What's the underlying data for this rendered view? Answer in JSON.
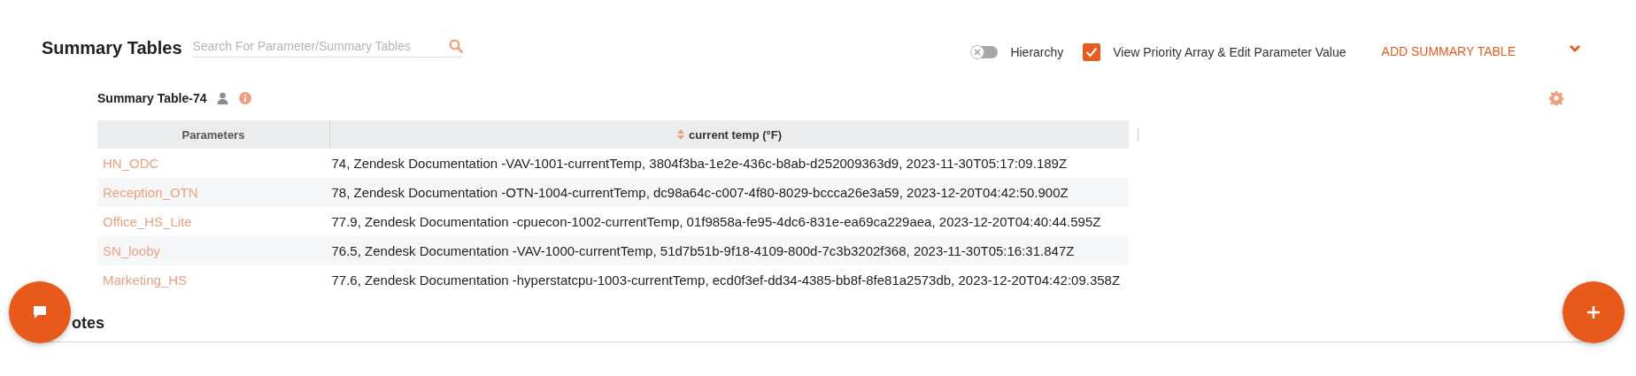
{
  "header": {
    "title": "Summary Tables",
    "search": {
      "placeholder": "Search For Parameter/Summary Tables"
    },
    "hierarchy": {
      "label": "Hierarchy",
      "on": false
    },
    "view_priority": {
      "label": "View Priority Array & Edit Parameter Value",
      "checked": true
    },
    "add_button": "ADD SUMMARY TABLE"
  },
  "summary_table": {
    "title": "Summary Table-74",
    "columns": [
      {
        "label": "Parameters",
        "sortable": false
      },
      {
        "label": "current temp  (°F)",
        "sortable": true
      }
    ],
    "rows": [
      {
        "parameter": "HN_ODC",
        "value": "74, Zendesk Documentation -VAV-1001-currentTemp, 3804f3ba-1e2e-436c-b8ab-d252009363d9, 2023-11-30T05:17:09.189Z"
      },
      {
        "parameter": "Reception_OTN",
        "value": "78, Zendesk Documentation -OTN-1004-currentTemp, dc98a64c-c007-4f80-8029-bccca26e3a59, 2023-12-20T04:42:50.900Z"
      },
      {
        "parameter": "Office_HS_Lite",
        "value": "77.9, Zendesk Documentation -cpuecon-1002-currentTemp, 01f9858a-fe95-4dc6-831e-ea69ca229aea, 2023-12-20T04:40:44.595Z"
      },
      {
        "parameter": "SN_looby",
        "value": "76.5, Zendesk Documentation -VAV-1000-currentTemp, 51d7b51b-9f18-4109-800d-7c3b3202f368, 2023-11-30T05:16:31.847Z"
      },
      {
        "parameter": "Marketing_HS",
        "value": "77.6, Zendesk Documentation -hyperstatcpu-1003-currentTemp, ecd0f3ef-dd34-4385-bb8f-8fe81a2573db, 2023-12-20T04:42:09.358Z"
      }
    ]
  },
  "sections": [
    {
      "title": "otes"
    }
  ]
}
